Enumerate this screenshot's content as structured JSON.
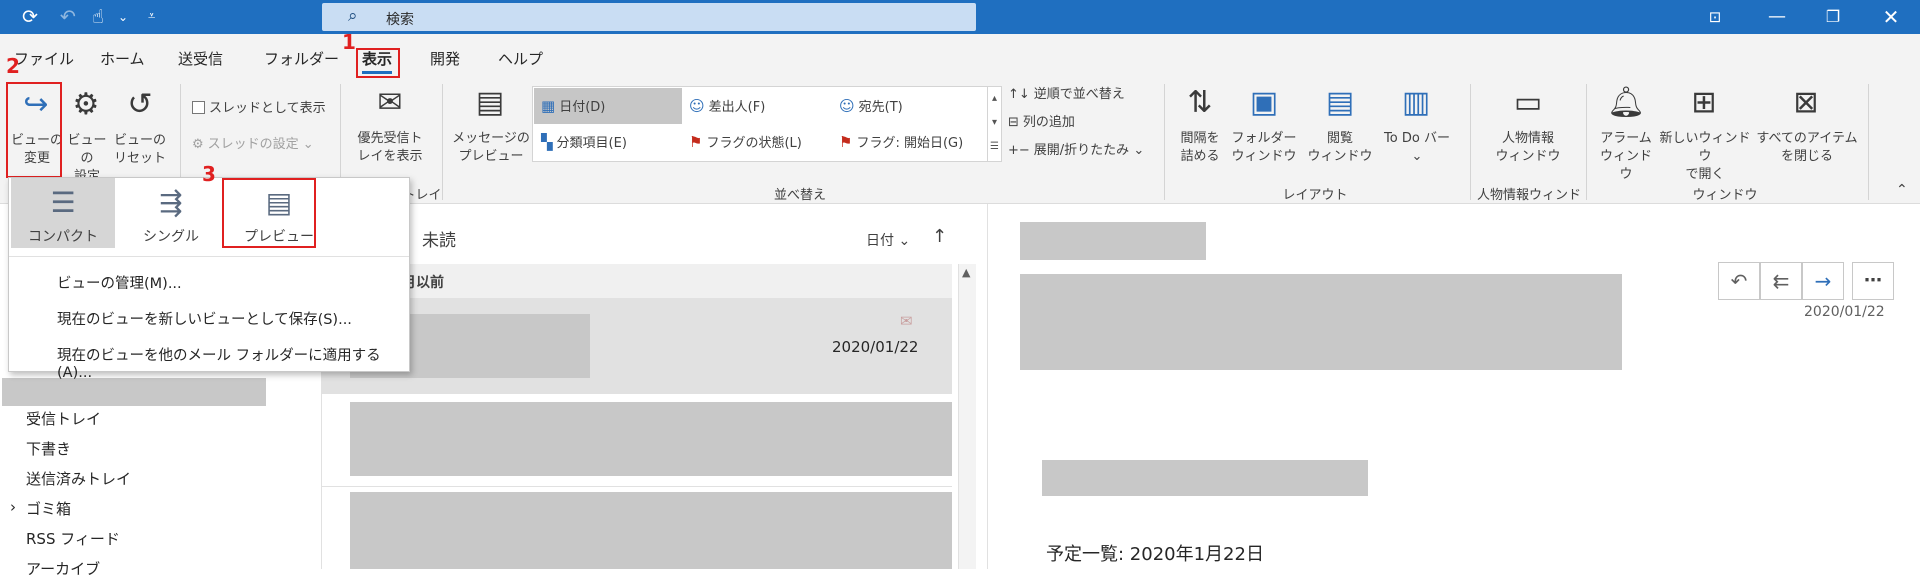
{
  "titlebar": {
    "search_placeholder": "検索",
    "icons": [
      "sync-icon",
      "undo-icon",
      "touch-mode-icon",
      "customize-icon",
      "ribbon-display-icon",
      "minimize-icon",
      "restore-icon",
      "close-icon"
    ]
  },
  "menu": {
    "tabs": [
      "ファイル",
      "ホーム",
      "送受信",
      "フォルダー",
      "表示",
      "開発",
      "ヘルプ"
    ],
    "active": "表示"
  },
  "ribbon": {
    "change_view": "ビューの\n変更",
    "view_settings": "ビューの\n設定",
    "reset_view": "ビューの\nリセット",
    "show_as_threads": "スレッドとして表示",
    "thread_settings": "スレッドの設定",
    "focused_inbox": "優先受信ト\nレイを表示",
    "focused_inbox_group": "優先受信トレイ",
    "message_preview": "メッセージの\nプレビュー",
    "arrangement": {
      "date": "日付(D)",
      "from": "差出人(F)",
      "to": "宛先(T)",
      "categories": "分類項目(E)",
      "flag_status": "フラグの状態(L)",
      "flag_start": "フラグ: 開始日(G)"
    },
    "reverse_sort": "逆順で並べ替え",
    "add_columns": "列の追加",
    "expand_collapse": "展開/折りたたみ",
    "arrangement_group": "並べ替え",
    "spacing": "間隔を\n詰める",
    "folder_pane": "フォルダー\nウィンドウ",
    "reading_pane": "閲覧\nウィンドウ",
    "todo_bar": "To Do バー",
    "layout_group": "レイアウト",
    "people_pane": "人物情報\nウィンドウ",
    "people_pane_group": "人物情報ウィンドウ",
    "reminders": "アラーム\nウィンドウ",
    "open_new_window": "新しいウィンドウ\nで開く",
    "close_all_items": "すべてのアイテム\nを閉じる",
    "window_group": "ウィンドウ"
  },
  "dropdown": {
    "options": [
      "コンパクト",
      "シングル",
      "プレビュー"
    ],
    "selected": "コンパクト",
    "items": [
      "ビューの管理(M)...",
      "現在のビューを新しいビューとして保存(S)...",
      "現在のビューを他のメール フォルダーに適用する(A)..."
    ]
  },
  "navpane": {
    "folders": [
      "受信トレイ",
      "下書き",
      "送信済みトレイ",
      "ゴミ箱",
      "RSS フィード",
      "アーカイブ"
    ]
  },
  "listpane": {
    "filter_unread": "未読",
    "sort_by": "日付",
    "group_header": "先月以前",
    "item_date": "2020/01/22"
  },
  "readpane": {
    "date": "2020/01/22",
    "body_heading": "予定一覧: 2020年1月22日"
  },
  "annotations": [
    "1",
    "2",
    "3"
  ],
  "colors": {
    "title_blue": "#1f6fc0",
    "annotation_red": "#e02020",
    "redaction_gray": "#c8c8c8"
  }
}
